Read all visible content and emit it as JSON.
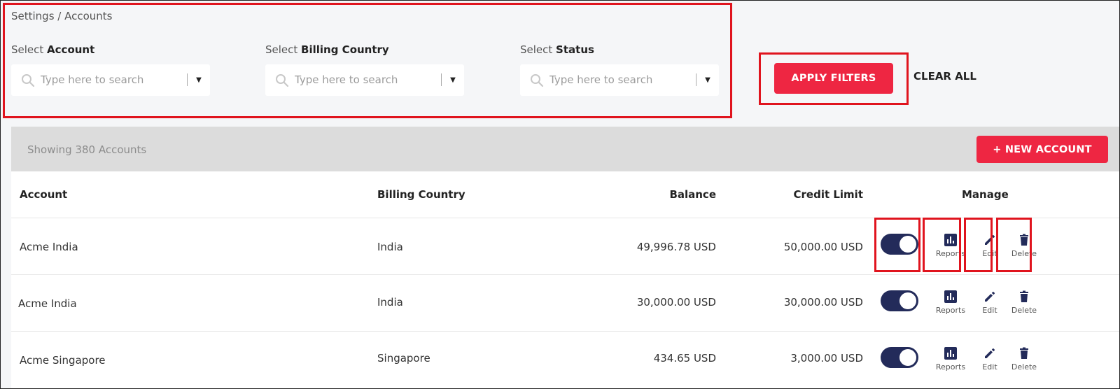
{
  "breadcrumb": "Settings / Accounts",
  "filters": [
    {
      "prefix": "Select ",
      "bold": "Account",
      "placeholder": "Type here to search"
    },
    {
      "prefix": "Select ",
      "bold": "Billing Country",
      "placeholder": "Type here to search"
    },
    {
      "prefix": "Select ",
      "bold": "Status",
      "placeholder": "Type here to search"
    }
  ],
  "actions": {
    "apply_label": "APPLY FILTERS",
    "clear_label": "CLEAR ALL"
  },
  "table": {
    "showing": "Showing 380 Accounts",
    "new_account_label": "+ NEW ACCOUNT",
    "headers": {
      "account": "Account",
      "country": "Billing Country",
      "balance": "Balance",
      "credit": "Credit Limit",
      "manage": "Manage"
    },
    "rows": [
      {
        "account": "Acme India",
        "country": "India",
        "balance": "49,996.78 USD",
        "credit": "50,000.00 USD",
        "active": true
      },
      {
        "account": "Acme India",
        "country": "India",
        "balance": "30,000.00 USD",
        "credit": "30,000.00 USD",
        "active": true
      },
      {
        "account": "Acme Singapore",
        "country": "Singapore",
        "balance": "434.65 USD",
        "credit": "3,000.00 USD",
        "active": true
      }
    ],
    "manage_labels": {
      "reports": "Reports",
      "edit": "Edit",
      "delete": "Delete"
    }
  },
  "colors": {
    "accent": "#ee2642",
    "toggle": "#232b5a",
    "highlight": "#e0141e",
    "icon": "#232b5a"
  },
  "icons": [
    "search-icon",
    "chevron-down-icon",
    "reports-icon",
    "edit-icon",
    "delete-icon"
  ]
}
